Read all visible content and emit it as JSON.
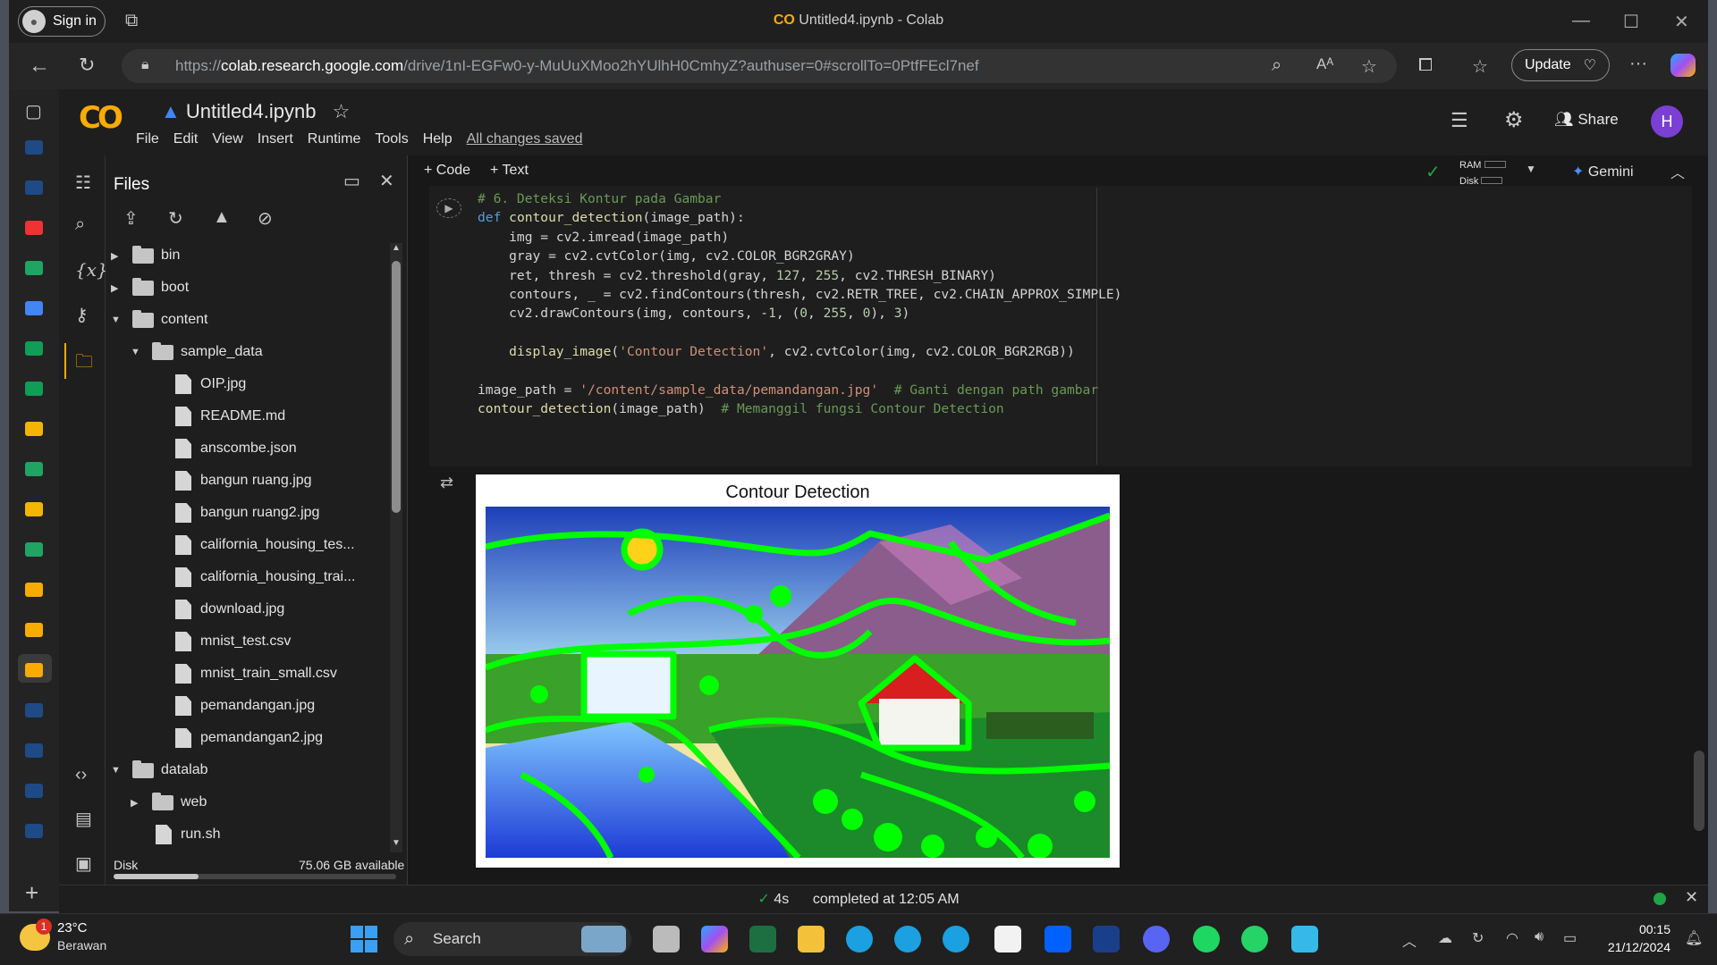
{
  "browser": {
    "sign_in_label": "Sign in",
    "tab_title": "Untitled4.ipynb - Colab",
    "url_prefix": "https://",
    "url_host": "colab.research.google.com",
    "url_path": "/drive/1nI-EGFw0-y-MuUuXMoo2hYUlhH0CmhyZ?authuser=0#scrollTo=0PtfFEcl7nef",
    "update_label": "Update",
    "window_controls": [
      "minimize-icon",
      "maximize-icon",
      "close-icon"
    ]
  },
  "colab": {
    "notebook_title": "Untitled4.ipynb",
    "menu": [
      "File",
      "Edit",
      "View",
      "Insert",
      "Runtime",
      "Tools",
      "Help"
    ],
    "save_status": "All changes saved",
    "share_label": "Share",
    "user_initial": "H",
    "toolbar": {
      "code_label": "+ Code",
      "text_label": "+ Text"
    },
    "ram_label": "RAM",
    "disk_label": "Disk",
    "gemini_label": "Gemini"
  },
  "files": {
    "title": "Files",
    "tree": [
      {
        "name": "bin",
        "type": "folder",
        "level": 0,
        "expanded": false
      },
      {
        "name": "boot",
        "type": "folder",
        "level": 0,
        "expanded": false
      },
      {
        "name": "content",
        "type": "folder",
        "level": 0,
        "expanded": true
      },
      {
        "name": "sample_data",
        "type": "folder",
        "level": 1,
        "expanded": true
      },
      {
        "name": "OIP.jpg",
        "type": "file",
        "level": 2
      },
      {
        "name": "README.md",
        "type": "file",
        "level": 2
      },
      {
        "name": "anscombe.json",
        "type": "file",
        "level": 2
      },
      {
        "name": "bangun ruang.jpg",
        "type": "file",
        "level": 2
      },
      {
        "name": "bangun ruang2.jpg",
        "type": "file",
        "level": 2
      },
      {
        "name": "california_housing_tes...",
        "type": "file",
        "level": 2
      },
      {
        "name": "california_housing_trai...",
        "type": "file",
        "level": 2
      },
      {
        "name": "download.jpg",
        "type": "file",
        "level": 2
      },
      {
        "name": "mnist_test.csv",
        "type": "file",
        "level": 2
      },
      {
        "name": "mnist_train_small.csv",
        "type": "file",
        "level": 2
      },
      {
        "name": "pemandangan.jpg",
        "type": "file",
        "level": 2
      },
      {
        "name": "pemandangan2.jpg",
        "type": "file",
        "level": 2
      },
      {
        "name": "datalab",
        "type": "folder",
        "level": 0,
        "expanded": true
      },
      {
        "name": "web",
        "type": "folder",
        "level": 1,
        "expanded": false
      },
      {
        "name": "run.sh",
        "type": "file",
        "level": 1
      }
    ],
    "disk_label": "Disk",
    "disk_available": "75.06 GB available",
    "disk_used_fraction": 0.3
  },
  "cell": {
    "code_lines": [
      "# 6. Deteksi Kontur pada Gambar",
      "def contour_detection(image_path):",
      "    img = cv2.imread(image_path)",
      "    gray = cv2.cvtColor(img, cv2.COLOR_BGR2GRAY)",
      "    ret, thresh = cv2.threshold(gray, 127, 255, cv2.THRESH_BINARY)",
      "    contours, _ = cv2.findContours(thresh, cv2.RETR_TREE, cv2.CHAIN_APPROX_SIMPLE)",
      "    cv2.drawContours(img, contours, -1, (0, 255, 0), 3)",
      "",
      "    display_image('Contour Detection', cv2.cvtColor(img, cv2.COLOR_BGR2RGB))",
      "",
      "image_path = '/content/sample_data/pemandangan.jpg'  # Ganti dengan path gambar",
      "contour_detection(image_path)  # Memanggil fungsi Contour Detection"
    ],
    "output_title": "Contour Detection"
  },
  "status": {
    "duration": "4s",
    "completed": "completed at 12:05 AM"
  },
  "taskbar": {
    "notification_count": "1",
    "temperature": "23°C",
    "weather": "Berawan",
    "search_label": "Search",
    "time": "00:15",
    "date": "21/12/2024"
  }
}
